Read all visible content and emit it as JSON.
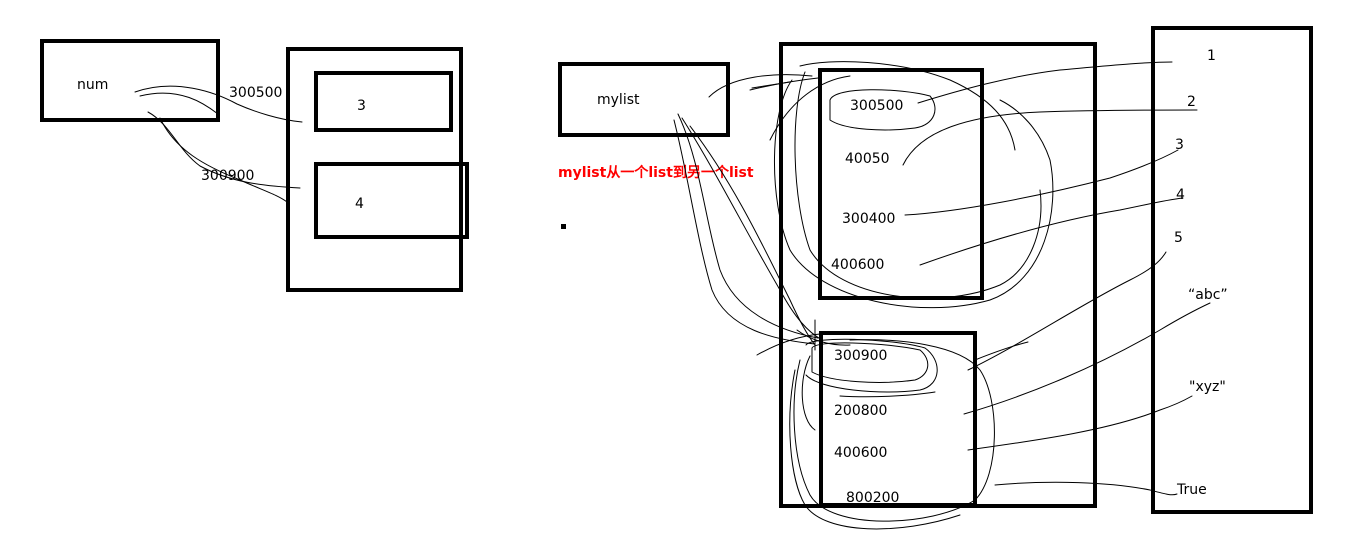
{
  "left": {
    "variable": "num",
    "addresses": [
      "300500",
      "300900"
    ],
    "values": [
      "3",
      "4"
    ]
  },
  "right": {
    "variable": "mylist",
    "note": "mylist从一个list到另一个list",
    "list1_addresses": [
      "300500",
      "40050",
      "300400",
      "400600"
    ],
    "list2_addresses": [
      "300900",
      "200800",
      "400600",
      "800200"
    ],
    "objects": [
      "1",
      "2",
      "3",
      "4",
      "5",
      "“abc”",
      "\"xyz\"",
      "True"
    ]
  }
}
